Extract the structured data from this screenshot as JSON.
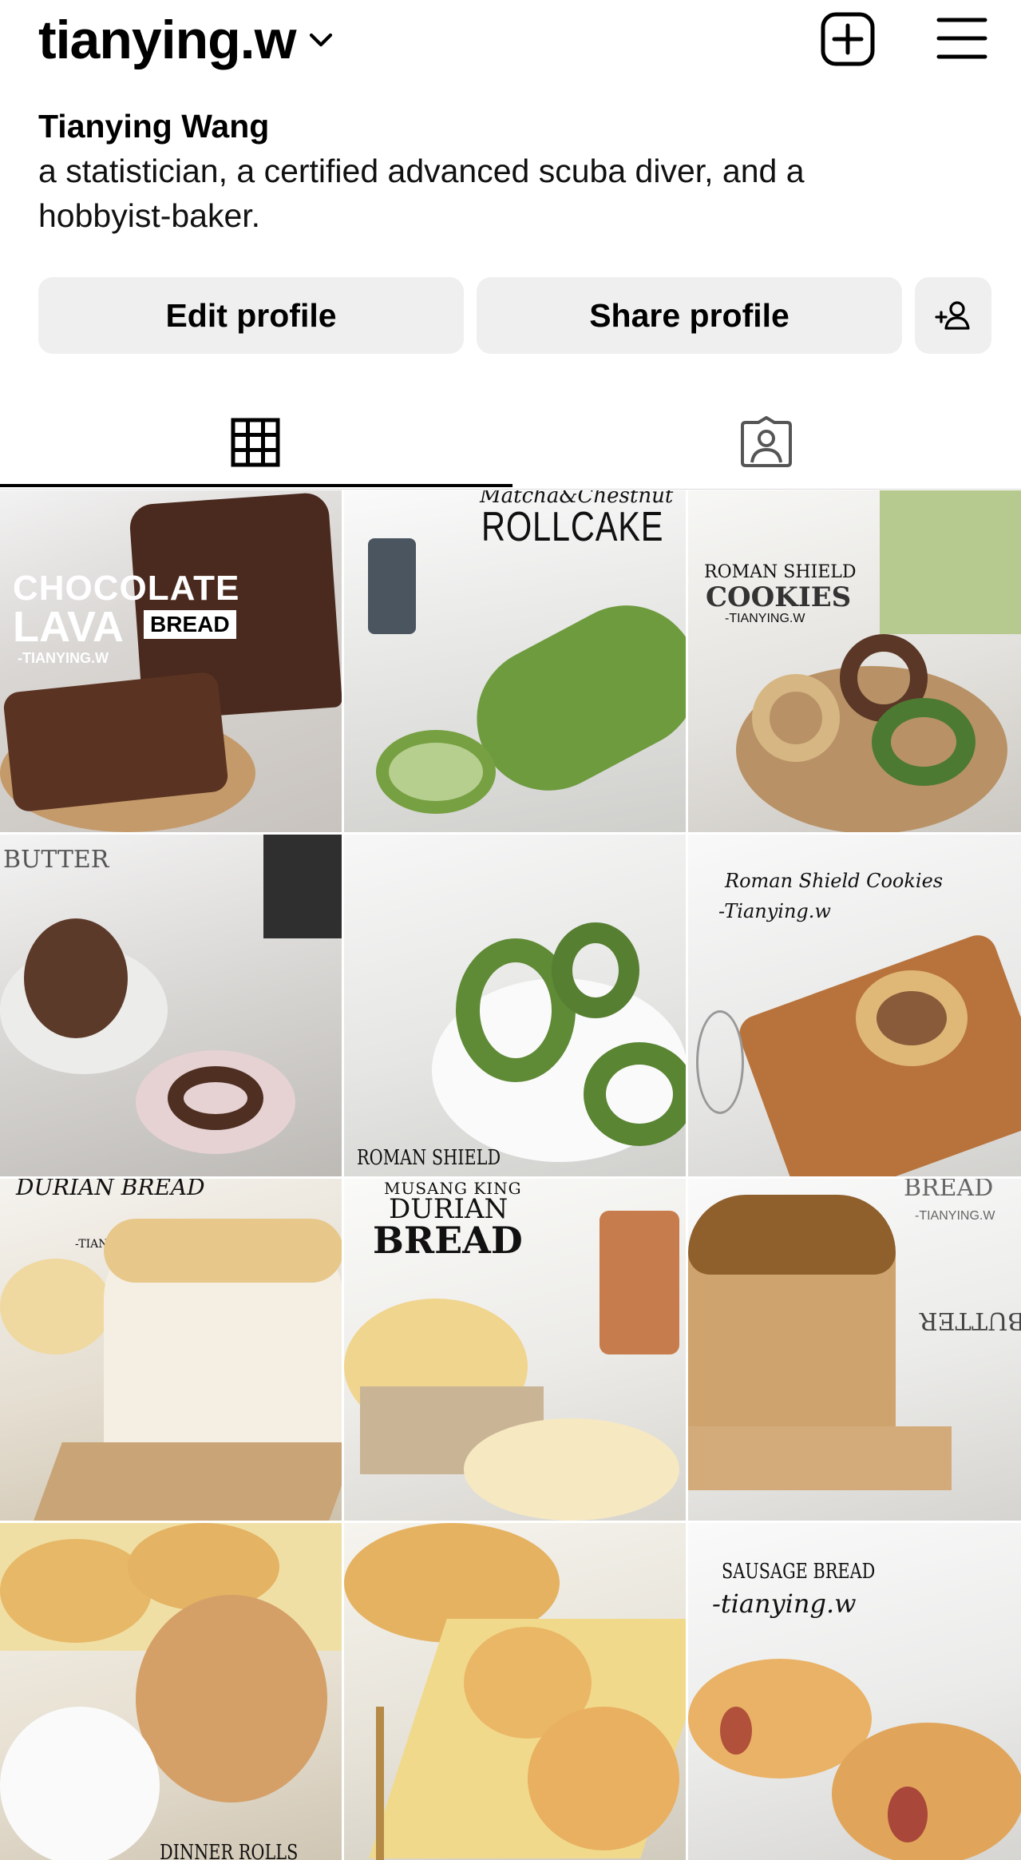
{
  "header": {
    "username": "tianying.w",
    "chevron_icon": "chevron-down-icon",
    "create_icon": "plus-square-icon",
    "menu_icon": "hamburger-menu-icon"
  },
  "profile": {
    "name": "Tianying Wang",
    "bio_line1": "a statistician, a certified advanced scuba diver, and a",
    "bio_line2": "hobbyist-baker."
  },
  "actions": {
    "edit_label": "Edit profile",
    "share_label": "Share profile",
    "discover_icon": "add-person-icon"
  },
  "tabs": {
    "grid_icon": "grid-icon",
    "tagged_icon": "tagged-person-icon",
    "active": "grid"
  },
  "posts": [
    {
      "t1": "CHOCOLATE",
      "t2": "LAVA",
      "t3": "BREAD",
      "t4": "-TIANYING.W"
    },
    {
      "t1": "Matcha&Chestnut",
      "t2": "ROLLCAKE"
    },
    {
      "t1": "ROMAN SHIELD",
      "t2": "COOKIES",
      "t3": "-TIANYING.W"
    },
    {
      "t1": "BUTTER"
    },
    {
      "t1": "ROMAN SHIELD"
    },
    {
      "t1": "Roman Shield Cookies",
      "t2": "-Tianying.w"
    },
    {
      "t1": "DURIAN BREAD",
      "t2": "-TIANYING.W"
    },
    {
      "t1": "MUSANG KING",
      "t2": "DURIAN",
      "t3": "BREAD"
    },
    {
      "t1": "BREAD",
      "t2": "-TIANYING.W",
      "t3": "BUTTER"
    },
    {
      "t1": "DINNER ROLLS"
    },
    {
      "t1": ""
    },
    {
      "t1": "SAUSAGE BREAD",
      "t2": "-tianying.w"
    }
  ]
}
